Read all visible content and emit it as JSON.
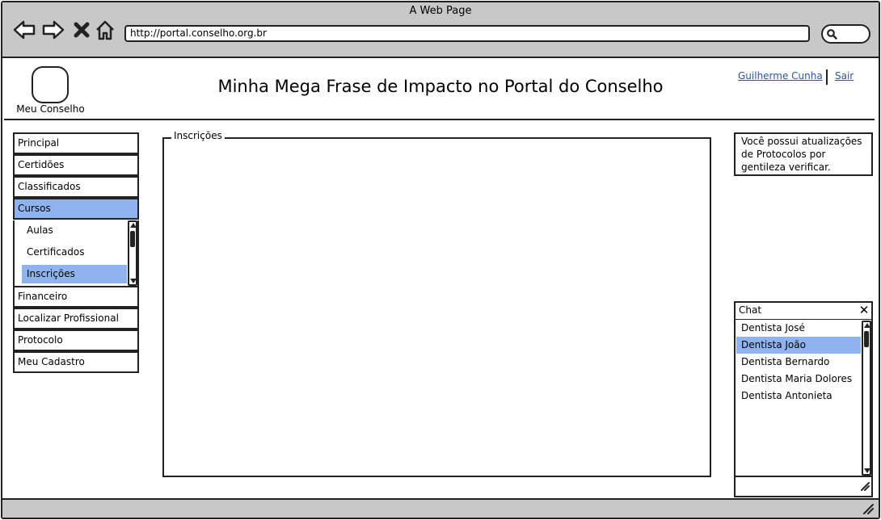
{
  "window": {
    "title": "A Web Page"
  },
  "browser": {
    "url": "http://portal.conselho.org.br",
    "nav_icons": [
      "back-arrow-icon",
      "forward-arrow-icon",
      "close-x-icon",
      "home-icon"
    ]
  },
  "header": {
    "logo_label": "Meu Conselho",
    "headline": "Minha Mega Frase de Impacto no Portal do Conselho",
    "user_name": "Guilherme Cunha",
    "logout_label": "Sair"
  },
  "nav": {
    "items": [
      {
        "label": "Principal"
      },
      {
        "label": "Certidões"
      },
      {
        "label": "Classificados"
      },
      {
        "label": "Cursos",
        "selected": true
      },
      {
        "label": "Financeiro"
      },
      {
        "label": "Localizar Profissional"
      },
      {
        "label": "Protocolo"
      },
      {
        "label": "Meu Cadastro"
      }
    ],
    "submenu": [
      {
        "label": "Aulas"
      },
      {
        "label": "Certificados"
      },
      {
        "label": "Inscrições",
        "selected": true
      }
    ]
  },
  "main": {
    "group_title": "Inscrições"
  },
  "notice": {
    "text": "Você possui atualizações de Protocolos por gentileza verificar."
  },
  "chat": {
    "title": "Chat",
    "contacts": [
      {
        "name": "Dentista José"
      },
      {
        "name": "Dentista João",
        "selected": true
      },
      {
        "name": "Dentista Bernardo"
      },
      {
        "name": "Dentista Maria Dolores"
      },
      {
        "name": "Dentista Antonieta"
      }
    ]
  },
  "colors": {
    "selection": "#8fb3ee",
    "link": "#2a56a8",
    "chrome": "#c8c8c8",
    "border": "#222222"
  }
}
